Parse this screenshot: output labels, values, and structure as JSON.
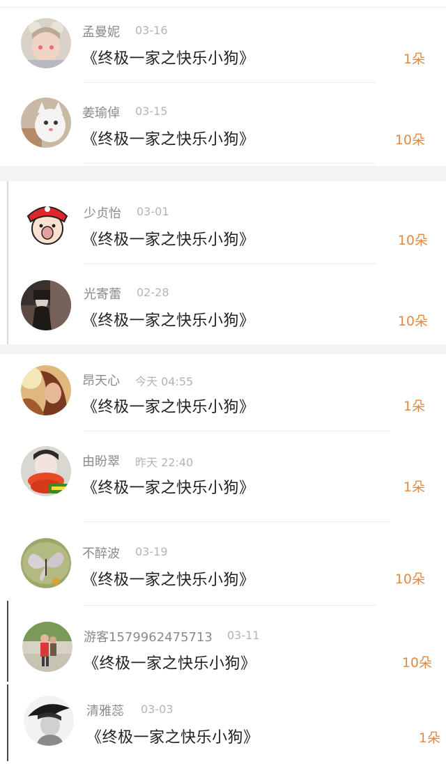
{
  "colors": {
    "count": "#e08a45",
    "name": "#8a8a8a",
    "time": "#b4b4b4",
    "gift": "#1f1f1f"
  },
  "records": [
    {
      "name": "孟曼妮",
      "time": "03-16",
      "gift": "《终极一家之快乐小狗》",
      "count": "1朵",
      "avatar": "boy-with-bear-ears-avatar"
    },
    {
      "name": "姜瑜倬",
      "time": "03-15",
      "gift": "《终极一家之快乐小狗》",
      "count": "10朵",
      "avatar": "white-cat-avatar"
    },
    {
      "name": "少贞怡",
      "time": "03-01",
      "gift": "《终极一家之快乐小狗》",
      "count": "10朵",
      "avatar": "cartoon-bandana-kid-avatar"
    },
    {
      "name": "光寄蕾",
      "time": "02-28",
      "gift": "《终极一家之快乐小狗》",
      "count": "10朵",
      "avatar": "dark-figure-avatar"
    },
    {
      "name": "昂天心",
      "time": "今天 04:55",
      "gift": "《终极一家之快乐小狗》",
      "count": "1朵",
      "avatar": "girl-warm-light-avatar"
    },
    {
      "name": "由盼翠",
      "time": "昨天 22:40",
      "gift": "《终极一家之快乐小狗》",
      "count": "1朵",
      "avatar": "girl-red-scarf-avatar"
    },
    {
      "name": "不醉波",
      "time": "03-19",
      "gift": "《终极一家之快乐小狗》",
      "count": "10朵",
      "avatar": "butterfly-avatar"
    },
    {
      "name": "游客1579962475713",
      "time": "03-11",
      "gift": "《终极一家之快乐小狗》",
      "count": "10朵",
      "avatar": "couple-outdoors-avatar"
    },
    {
      "name": "清雅蕊",
      "time": "03-03",
      "gift": "《终极一家之快乐小狗》",
      "count": "1朵",
      "avatar": "monochrome-portrait-avatar"
    }
  ]
}
